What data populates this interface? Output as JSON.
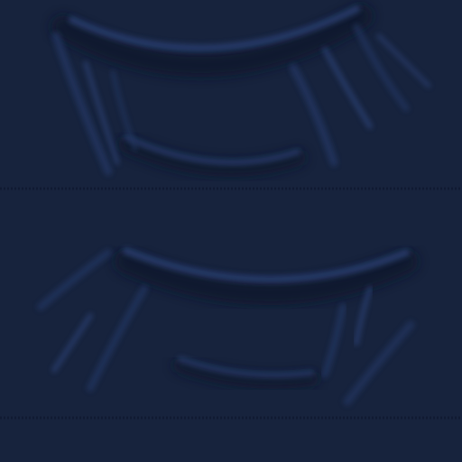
{
  "colors": {
    "background": "#17233d",
    "background_shade": "#15203a",
    "fold_shadow": "#0e1629",
    "fold_highlight": "#2a4072",
    "seam": "#101a31"
  },
  "texture": {
    "kind": "embossed fabric folds",
    "tiles": 2
  }
}
